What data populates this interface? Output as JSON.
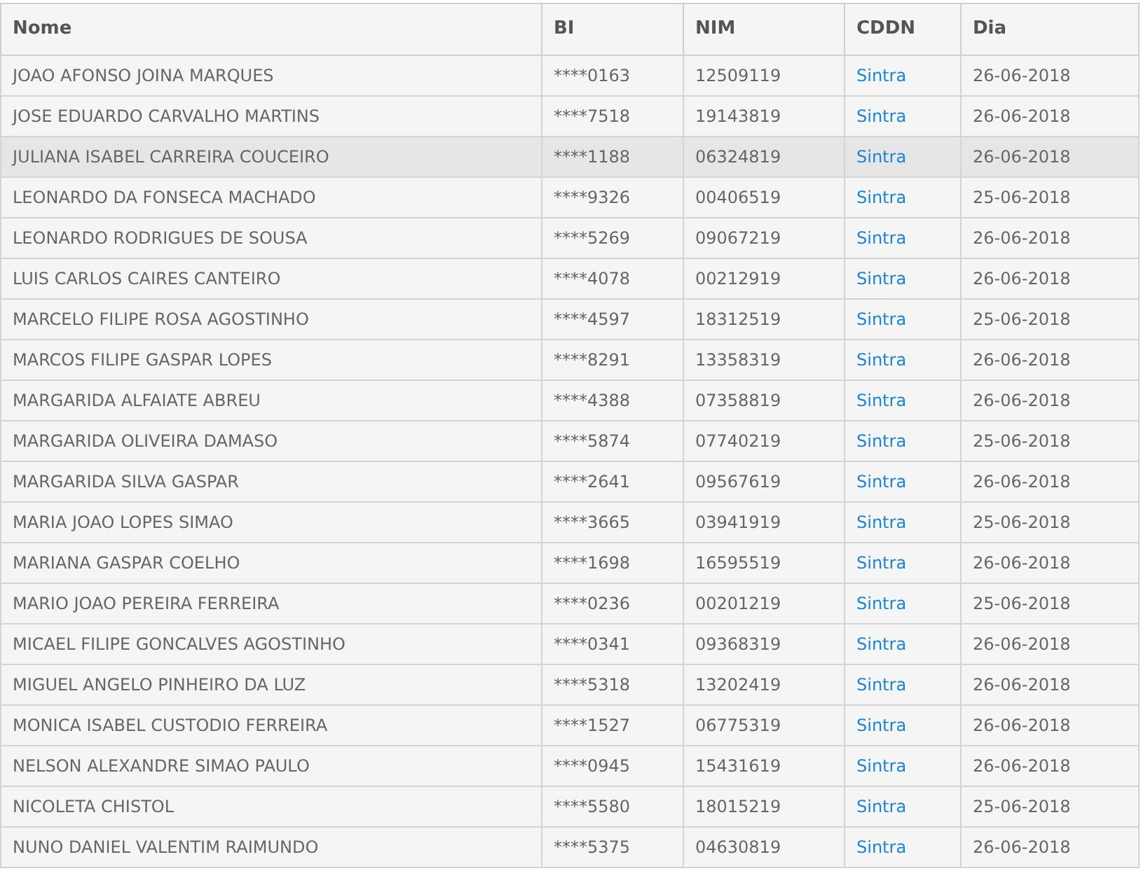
{
  "table": {
    "columns": [
      "Nome",
      "BI",
      "NIM",
      "CDDN",
      "Dia"
    ],
    "rows": [
      {
        "selected": false,
        "cells": [
          "JOAO AFONSO JOINA MARQUES",
          "****0163",
          "12509119",
          "Sintra",
          "26-06-2018"
        ]
      },
      {
        "selected": false,
        "cells": [
          "JOSE EDUARDO CARVALHO MARTINS",
          "****7518",
          "19143819",
          "Sintra",
          "26-06-2018"
        ]
      },
      {
        "selected": true,
        "cells": [
          "JULIANA ISABEL CARREIRA COUCEIRO",
          "****1188",
          "06324819",
          "Sintra",
          "26-06-2018"
        ]
      },
      {
        "selected": false,
        "cells": [
          "LEONARDO DA FONSECA MACHADO",
          "****9326",
          "00406519",
          "Sintra",
          "25-06-2018"
        ]
      },
      {
        "selected": false,
        "cells": [
          "LEONARDO RODRIGUES DE SOUSA",
          "****5269",
          "09067219",
          "Sintra",
          "26-06-2018"
        ]
      },
      {
        "selected": false,
        "cells": [
          "LUIS CARLOS CAIRES CANTEIRO",
          "****4078",
          "00212919",
          "Sintra",
          "26-06-2018"
        ]
      },
      {
        "selected": false,
        "cells": [
          "MARCELO FILIPE ROSA AGOSTINHO",
          "****4597",
          "18312519",
          "Sintra",
          "25-06-2018"
        ]
      },
      {
        "selected": false,
        "cells": [
          "MARCOS FILIPE GASPAR LOPES",
          "****8291",
          "13358319",
          "Sintra",
          "26-06-2018"
        ]
      },
      {
        "selected": false,
        "cells": [
          "MARGARIDA ALFAIATE ABREU",
          "****4388",
          "07358819",
          "Sintra",
          "26-06-2018"
        ]
      },
      {
        "selected": false,
        "cells": [
          "MARGARIDA OLIVEIRA DAMASO",
          "****5874",
          "07740219",
          "Sintra",
          "25-06-2018"
        ]
      },
      {
        "selected": false,
        "cells": [
          "MARGARIDA SILVA GASPAR",
          "****2641",
          "09567619",
          "Sintra",
          "26-06-2018"
        ]
      },
      {
        "selected": false,
        "cells": [
          "MARIA JOAO LOPES SIMAO",
          "****3665",
          "03941919",
          "Sintra",
          "25-06-2018"
        ]
      },
      {
        "selected": false,
        "cells": [
          "MARIANA GASPAR COELHO",
          "****1698",
          "16595519",
          "Sintra",
          "26-06-2018"
        ]
      },
      {
        "selected": false,
        "cells": [
          "MARIO JOAO PEREIRA FERREIRA",
          "****0236",
          "00201219",
          "Sintra",
          "25-06-2018"
        ]
      },
      {
        "selected": false,
        "cells": [
          "MICAEL FILIPE GONCALVES AGOSTINHO",
          "****0341",
          "09368319",
          "Sintra",
          "26-06-2018"
        ]
      },
      {
        "selected": false,
        "cells": [
          "MIGUEL ANGELO PINHEIRO DA LUZ",
          "****5318",
          "13202419",
          "Sintra",
          "26-06-2018"
        ]
      },
      {
        "selected": false,
        "cells": [
          "MONICA ISABEL CUSTODIO FERREIRA",
          "****1527",
          "06775319",
          "Sintra",
          "26-06-2018"
        ]
      },
      {
        "selected": false,
        "cells": [
          "NELSON ALEXANDRE SIMAO PAULO",
          "****0945",
          "15431619",
          "Sintra",
          "26-06-2018"
        ]
      },
      {
        "selected": false,
        "cells": [
          "NICOLETA CHISTOL",
          "****5580",
          "18015219",
          "Sintra",
          "25-06-2018"
        ]
      },
      {
        "selected": false,
        "cells": [
          "NUNO DANIEL VALENTIM RAIMUNDO",
          "****5375",
          "04630819",
          "Sintra",
          "26-06-2018"
        ]
      }
    ]
  }
}
